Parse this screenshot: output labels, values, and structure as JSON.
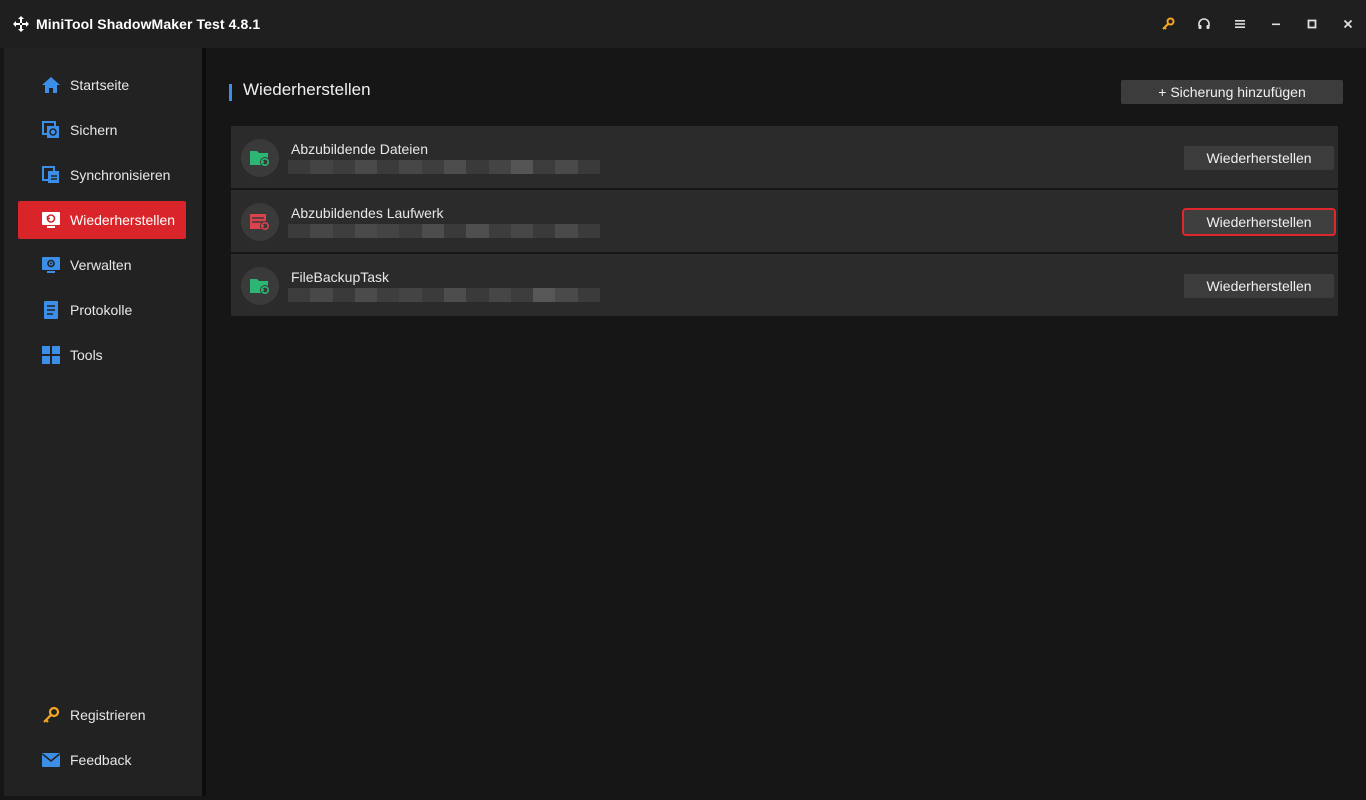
{
  "app": {
    "title": "MiniTool ShadowMaker Test 4.8.1"
  },
  "titlebar": {
    "controls": [
      {
        "name": "key-icon",
        "color": "#f5a623"
      },
      {
        "name": "headset-icon",
        "color": "#e0e0e0"
      },
      {
        "name": "menu-icon",
        "color": "#e0e0e0"
      },
      {
        "name": "minimize-icon",
        "color": "#e0e0e0"
      },
      {
        "name": "maximize-icon",
        "color": "#e0e0e0"
      },
      {
        "name": "close-icon",
        "color": "#e0e0e0"
      }
    ]
  },
  "sidebar": {
    "items": [
      {
        "label": "Startseite",
        "icon": "home-icon",
        "active": false
      },
      {
        "label": "Sichern",
        "icon": "backup-icon",
        "active": false
      },
      {
        "label": "Synchronisieren",
        "icon": "sync-icon",
        "active": false
      },
      {
        "label": "Wiederherstellen",
        "icon": "restore-icon",
        "active": true
      },
      {
        "label": "Verwalten",
        "icon": "manage-icon",
        "active": false
      },
      {
        "label": "Protokolle",
        "icon": "logs-icon",
        "active": false
      },
      {
        "label": "Tools",
        "icon": "tools-icon",
        "active": false
      }
    ],
    "bottom_items": [
      {
        "label": "Registrieren",
        "icon": "key-icon"
      },
      {
        "label": "Feedback",
        "icon": "mail-icon"
      }
    ]
  },
  "main": {
    "title": "Wiederherstellen",
    "add_backup_label": "+ Sicherung hinzufügen",
    "tasks": [
      {
        "name": "Abzubildende Dateien",
        "icon": "green-folder-icon",
        "restore_label": "Wiederherstellen",
        "highlighted": false
      },
      {
        "name": "Abzubildendes Laufwerk",
        "icon": "red-drive-icon",
        "restore_label": "Wiederherstellen",
        "highlighted": true
      },
      {
        "name": "FileBackupTask",
        "icon": "green-folder-icon",
        "restore_label": "Wiederherstellen",
        "highlighted": false
      }
    ]
  },
  "colors": {
    "accent_red": "#d9252a",
    "accent_blue": "#3b8fe8",
    "folder_green": "#2bb673",
    "drive_red": "#d9434b",
    "key_orange": "#f5a623"
  }
}
